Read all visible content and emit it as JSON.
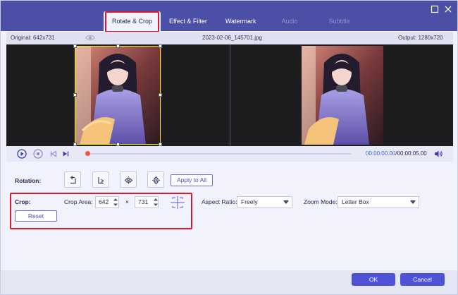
{
  "tabs": [
    {
      "label": "Rotate & Crop",
      "state": "active"
    },
    {
      "label": "Effect & Filter",
      "state": "normal"
    },
    {
      "label": "Watermark",
      "state": "normal"
    },
    {
      "label": "Audio",
      "state": "disabled"
    },
    {
      "label": "Subtitle",
      "state": "disabled"
    }
  ],
  "window": {
    "maximize_icon": "maximize-icon",
    "close_icon": "close-icon"
  },
  "info": {
    "original": "Original: 642x731",
    "filename": "2023-02-06_145701.jpg",
    "output": "Output: 1280x720"
  },
  "playback": {
    "time_current": "00:00:00.00",
    "time_total": "/00:00:05.00",
    "progress": 0
  },
  "rotation": {
    "label": "Rotation:",
    "buttons": [
      "rotate-left-icon",
      "rotate-right-icon",
      "flip-horizontal-icon",
      "flip-vertical-icon"
    ],
    "apply_all": "Apply to All"
  },
  "crop": {
    "label": "Crop:",
    "area_label": "Crop Area:",
    "width": "642",
    "times": "×",
    "height": "731",
    "reset": "Reset"
  },
  "aspect": {
    "label": "Aspect Ratio:",
    "value": "Freely"
  },
  "zoom": {
    "label": "Zoom Mode:",
    "value": "Letter Box"
  },
  "footer": {
    "ok": "OK",
    "cancel": "Cancel"
  },
  "colors": {
    "accent": "#4f52d4",
    "header": "#4c4fa6",
    "highlight": "#e0182e",
    "crop_frame": "#e6f000"
  }
}
